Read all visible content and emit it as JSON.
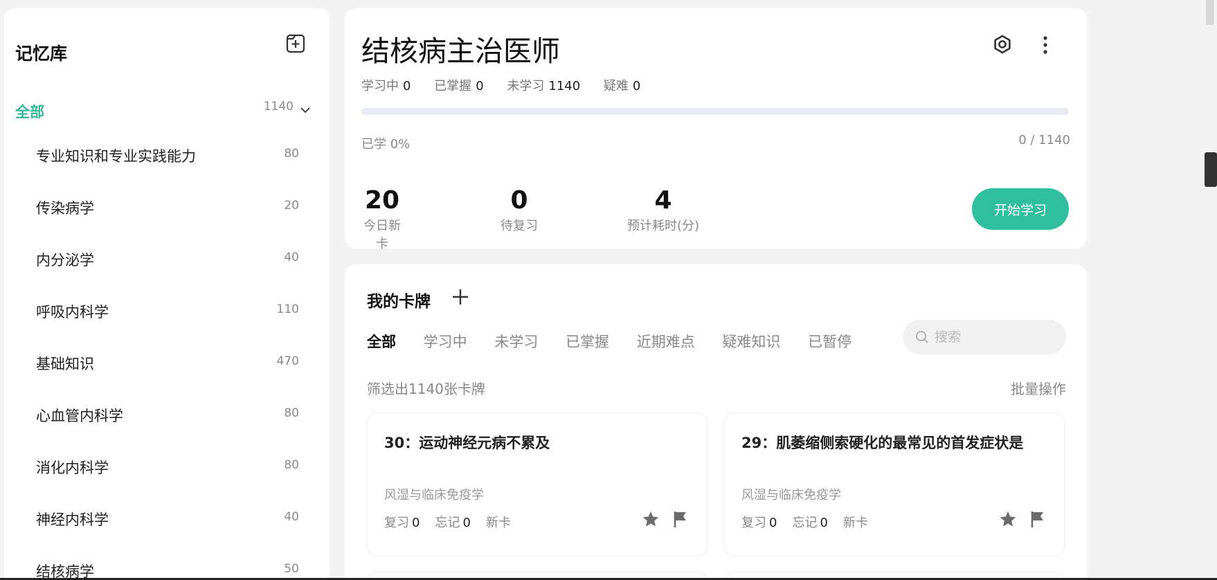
{
  "sidebar": {
    "title": "记忆库",
    "all": {
      "label": "全部",
      "count": "1140"
    },
    "items": [
      {
        "label": "专业知识和专业实践能力",
        "count": "80"
      },
      {
        "label": "传染病学",
        "count": "20"
      },
      {
        "label": "内分泌学",
        "count": "40"
      },
      {
        "label": "呼吸内科学",
        "count": "110"
      },
      {
        "label": "基础知识",
        "count": "470"
      },
      {
        "label": "心血管内科学",
        "count": "80"
      },
      {
        "label": "消化内科学",
        "count": "80"
      },
      {
        "label": "神经内科学",
        "count": "40"
      },
      {
        "label": "结核病学",
        "count": "50"
      }
    ]
  },
  "overview": {
    "title": "结核病主治医师",
    "status": [
      {
        "label": "学习中",
        "value": "0"
      },
      {
        "label": "已掌握",
        "value": "0"
      },
      {
        "label": "未学习",
        "value": "1140"
      },
      {
        "label": "疑难",
        "value": "0"
      }
    ],
    "progress_fraction": 0,
    "learned_label": "已学 0%",
    "progress_count": "0 / 1140",
    "stats": [
      {
        "value": "20",
        "label": "今日新卡"
      },
      {
        "value": "0",
        "label": "待复习"
      },
      {
        "value": "4",
        "label": "预计耗时(分)"
      }
    ],
    "start_label": "开始学习"
  },
  "cards_section": {
    "title": "我的卡牌",
    "tabs": [
      "全部",
      "学习中",
      "未学习",
      "已掌握",
      "近期难点",
      "疑难知识",
      "已暂停"
    ],
    "active_tab": 0,
    "search_placeholder": "搜索",
    "filter_summary": "筛选出1140张卡牌",
    "batch_label": "批量操作",
    "cards": [
      {
        "title": "30：运动神经元病不累及",
        "subject": "风湿与临床免疫学",
        "review_label": "复习",
        "review": "0",
        "forget_label": "忘记",
        "forget": "0",
        "state": "新卡"
      },
      {
        "title": "29：肌萎缩侧索硬化的最常见的首发症状是",
        "subject": "风湿与临床免疫学",
        "review_label": "复习",
        "review": "0",
        "forget_label": "忘记",
        "forget": "0",
        "state": "新卡"
      }
    ]
  },
  "colors": {
    "accent": "#2fb99a",
    "button": "#2fbe9e",
    "icon_gray": "#6b6b6b"
  },
  "icons": {
    "new_deck": "add-folder-icon",
    "chevron": "chevron-down-icon",
    "eye": "eye-icon",
    "more": "more-vertical-icon",
    "add": "plus-icon",
    "search": "search-icon",
    "star": "star-icon",
    "flag": "flag-icon"
  }
}
